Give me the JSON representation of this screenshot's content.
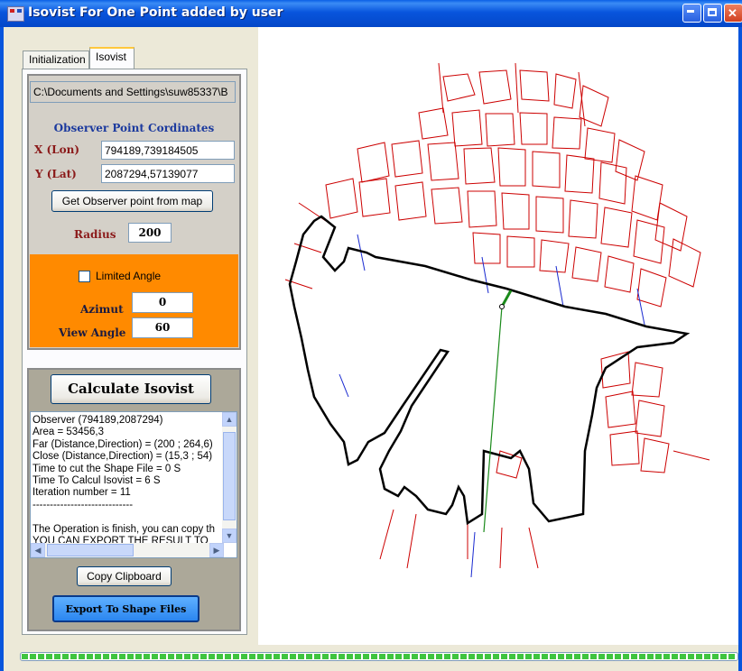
{
  "window": {
    "title": "Isovist For One Point added by user"
  },
  "tabs": [
    "Initialization",
    "Isovist"
  ],
  "form": {
    "path": "C:\\Documents and Settings\\suw85337\\B",
    "observer_title": "Observer Point Cordinates",
    "x_label": "X (Lon)",
    "x_value": "794189,739184505",
    "y_label": "Y (Lat)",
    "y_value": "2087294,57139077",
    "get_point_button": "Get Observer point from map",
    "radius_label": "Radius",
    "radius_value": "200",
    "limited_angle_label": "Limited Angle",
    "limited_angle_checked": false,
    "azimut_label": "Azimut",
    "azimut_value": "0",
    "view_angle_label": "View Angle",
    "view_angle_value": "60"
  },
  "actions": {
    "calculate_label": "Calculate Isovist",
    "copy_label": "Copy Clipboard",
    "export_label": "Export To Shape Files"
  },
  "output_lines": [
    "Observer (794189,2087294)",
    "Area = 53456,3",
    "Far (Distance,Direction) = (200 ; 264,6)",
    "Close (Distance,Direction) = (15,3 ; 54)",
    "Time to cut the Shape File =  0 S",
    "Time To Calcul Isovist =  6 S",
    "Iteration number =  11",
    "-----------------------------",
    "",
    "The Operation is finish, you can copy th",
    "YOU CAN EXPORT THE RESULT TO"
  ],
  "progress": {
    "fraction": 1.0
  },
  "colors": {
    "accent_orange": "#ff8a00",
    "building_red": "#cc0000",
    "isovist_black": "#000000",
    "ray_green": "#1a8a1a",
    "edge_blue": "#1a2ad0",
    "export_button": "#3399ff"
  }
}
